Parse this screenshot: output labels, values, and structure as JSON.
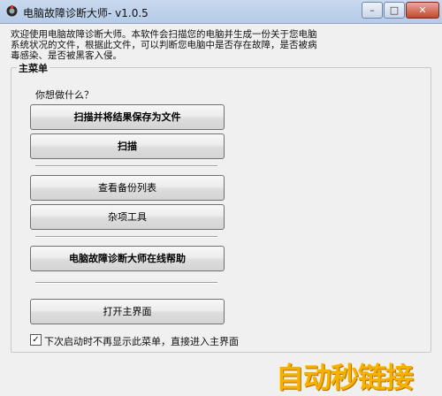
{
  "window": {
    "title": "电脑故障诊断大师- v1.0.5",
    "controls": {
      "minimize": "–",
      "maximize": "□",
      "close": "✕"
    }
  },
  "description": {
    "line1": "欢迎使用电脑故障诊断大师。本软件会扫描您的电脑并生成一份关于您电脑",
    "line2": "系统状况的文件，根据此文件，可以判断您电脑中是否存在故障，是否被病",
    "line3": "毒感染、是否被黑客入侵。"
  },
  "main_menu": {
    "legend": "主菜单",
    "question": "你想做什么？",
    "buttons": {
      "scan_save": "扫描并将结果保存为文件",
      "scan": "扫描",
      "view_backups": "查看备份列表",
      "misc_tools": "杂项工具",
      "online_help": "电脑故障诊断大师在线帮助",
      "open_main": "打开主界面"
    }
  },
  "checkbox": {
    "checked": true,
    "mark": "✓",
    "label": "下次启动时不再显示此菜单，直接进入主界面"
  },
  "watermark": {
    "text": "自动秒链接"
  }
}
